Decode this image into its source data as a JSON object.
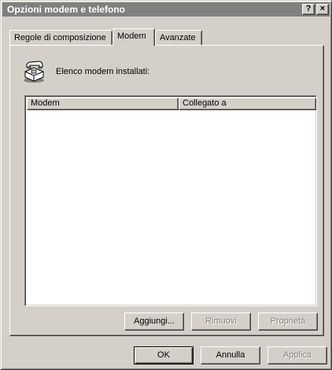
{
  "window": {
    "title": "Opzioni modem e telefono",
    "help_label": "?",
    "close_label": "×"
  },
  "tabs": [
    {
      "label": "Regole di composizione",
      "active": false
    },
    {
      "label": "Modem",
      "active": true
    },
    {
      "label": "Avanzate",
      "active": false
    }
  ],
  "panel": {
    "icon": "telephone-icon",
    "installed_label": "Elenco modem installati:",
    "list": {
      "columns": [
        "Modem",
        "Collegato a"
      ],
      "rows": []
    },
    "buttons": {
      "add": "Aggiungi...",
      "remove": "Rimuovi",
      "properties": "Proprietà"
    }
  },
  "footer": {
    "ok": "OK",
    "cancel": "Annulla",
    "apply": "Applica"
  }
}
